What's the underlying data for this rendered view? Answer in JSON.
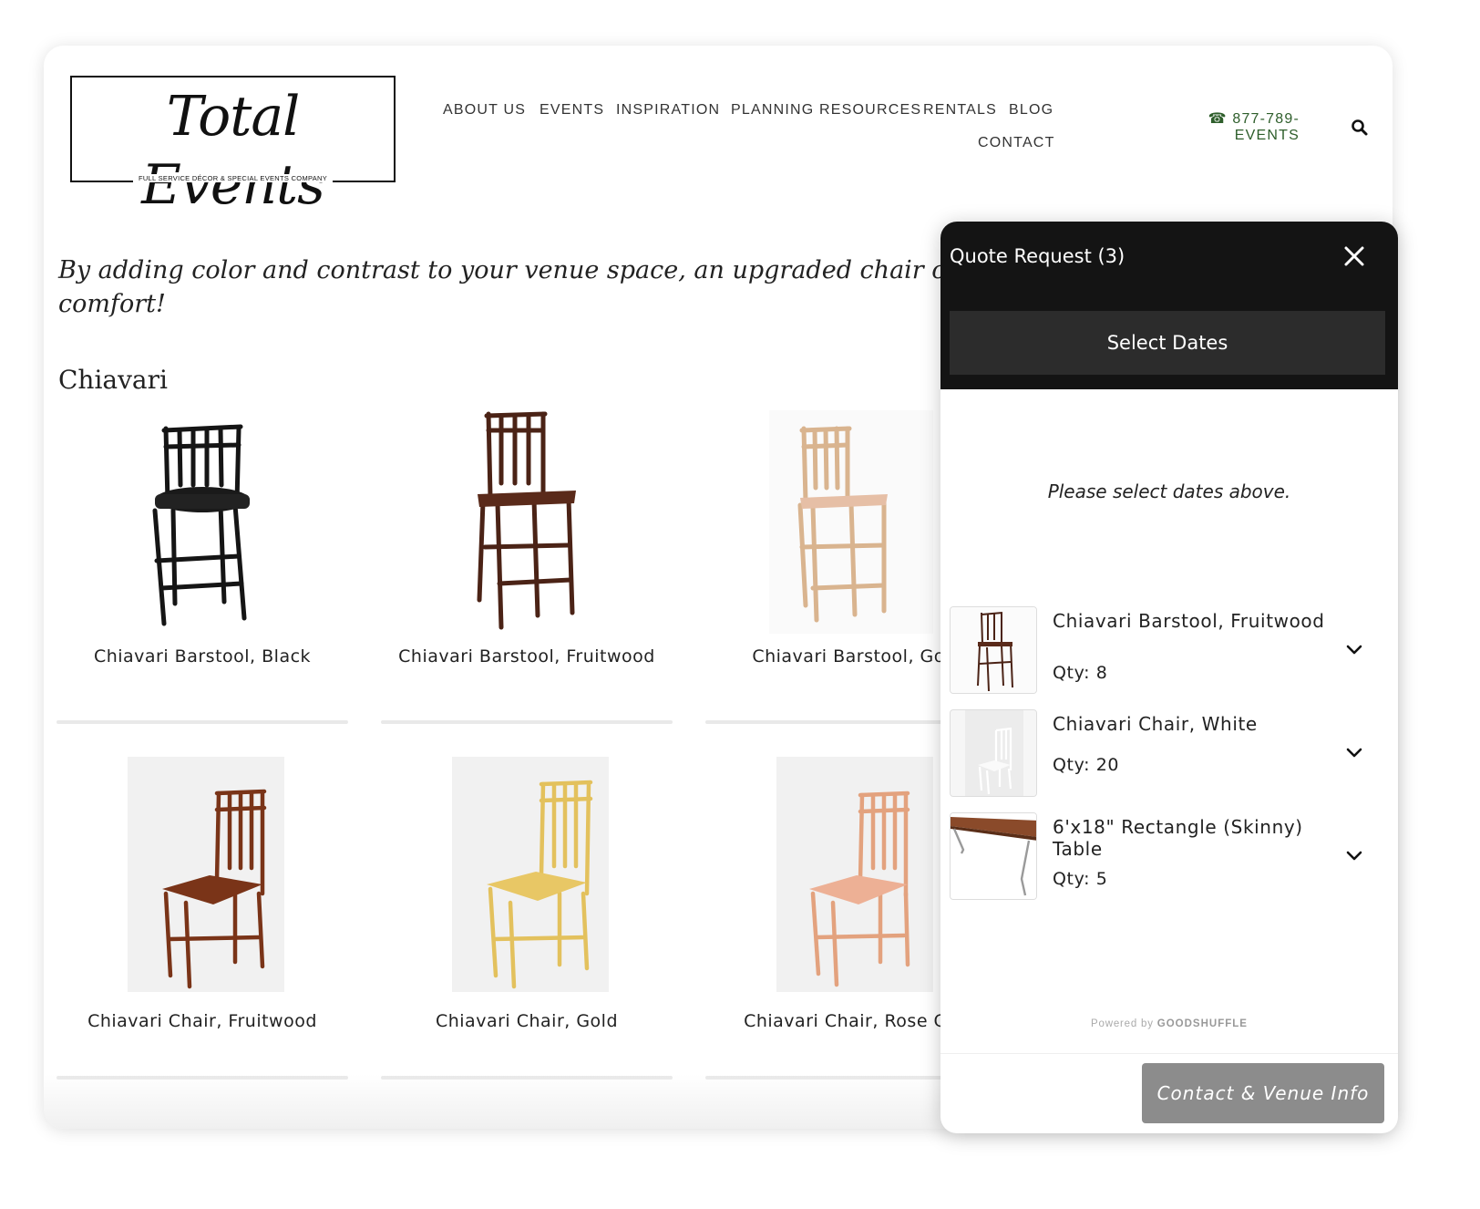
{
  "brand": {
    "logo_text": "Total Events",
    "tagline": "FULL SERVICE DÉCOR & SPECIAL EVENTS COMPANY"
  },
  "nav": {
    "items": [
      "ABOUT US",
      "EVENTS",
      "INSPIRATION",
      "PLANNING RESOURCES",
      "RENTALS",
      "BLOG",
      "CONTACT"
    ],
    "phone_line1": "☎ 877-789-",
    "phone_line2": "EVENTS",
    "search_icon": "search-icon"
  },
  "intro": {
    "line1": "By adding color and contrast to your venue space, an upgraded chair can make all t",
    "line2": "comfort!"
  },
  "section": {
    "title": "Chiavari"
  },
  "products": [
    {
      "label": "Chiavari Barstool, Black"
    },
    {
      "label": "Chiavari Barstool, Fruitwood"
    },
    {
      "label": "Chiavari Barstool, Gol"
    },
    {
      "label": "Chiavari Chair, Fruitwood"
    },
    {
      "label": "Chiavari Chair, Gold"
    },
    {
      "label": "Chiavari Chair, Rose Go"
    }
  ],
  "quote": {
    "title": "Quote Request (3)",
    "select_dates": "Select Dates",
    "hint": "Please select dates above.",
    "items": [
      {
        "name": "Chiavari Barstool, Fruitwood",
        "qty": "Qty: 8"
      },
      {
        "name": "Chiavari Chair, White",
        "qty": "Qty: 20"
      },
      {
        "name": "6'x18\" Rectangle (Skinny) Table",
        "qty": "Qty: 5"
      }
    ],
    "powered_prefix": "Powered by",
    "powered_brand": "GOODSHUFFLE",
    "contact_button": "Contact & Venue Info"
  },
  "colors": {
    "phone": "#2e5e2b",
    "widget_header": "#141414",
    "select_dates_bg": "#2c2c2c",
    "contact_button": "#8c8c8c"
  }
}
